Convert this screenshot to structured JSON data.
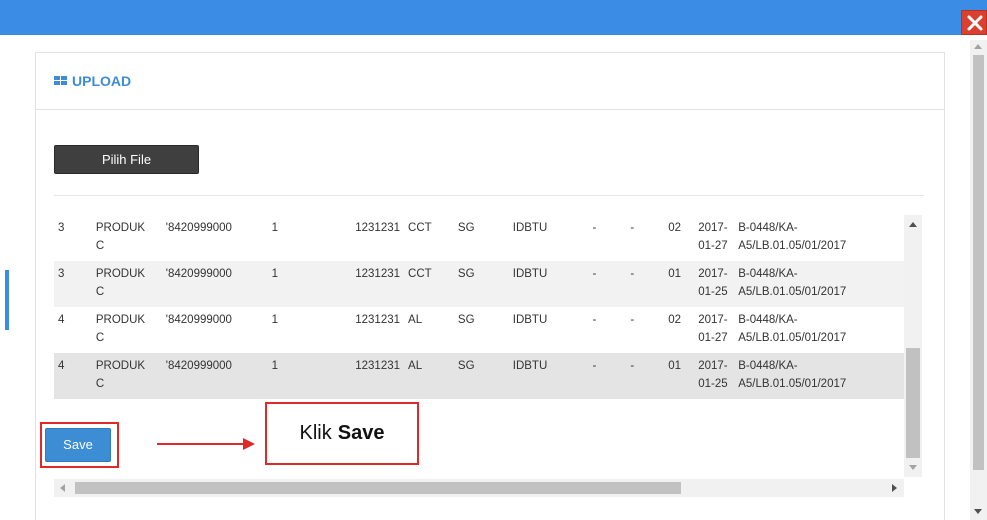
{
  "dialog": {
    "title": "UPLOAD",
    "choose_file_label": "Pilih File",
    "save_label": "Save"
  },
  "table": {
    "rows": [
      [
        "3",
        "PRODUK\nC",
        "'8420999000",
        "1",
        "1231231",
        "CCT",
        "SG",
        "IDBTU",
        "-",
        "-",
        "02",
        "2017-\n01-27",
        "B-0448/KA-\nA5/LB.01.05/01/2017"
      ],
      [
        "3",
        "PRODUK\nC",
        "'8420999000",
        "1",
        "1231231",
        "CCT",
        "SG",
        "IDBTU",
        "-",
        "-",
        "01",
        "2017-\n01-25",
        "B-0448/KA-\nA5/LB.01.05/01/2017"
      ],
      [
        "4",
        "PRODUK\nC",
        "'8420999000",
        "1",
        "1231231",
        "AL",
        "SG",
        "IDBTU",
        "-",
        "-",
        "02",
        "2017-\n01-27",
        "B-0448/KA-\nA5/LB.01.05/01/2017"
      ],
      [
        "4",
        "PRODUK\nC",
        "'8420999000",
        "1",
        "1231231",
        "AL",
        "SG",
        "IDBTU",
        "-",
        "-",
        "01",
        "2017-\n01-25",
        "B-0448/KA-\nA5/LB.01.05/01/2017"
      ]
    ]
  },
  "annotation": {
    "text_prefix": "Klik",
    "text_bold": "Save",
    "highlight_color": "#e02a2a"
  },
  "colors": {
    "titlebar": "#3a8ce4",
    "accent": "#3c8dd4",
    "close": "#d9402f"
  }
}
